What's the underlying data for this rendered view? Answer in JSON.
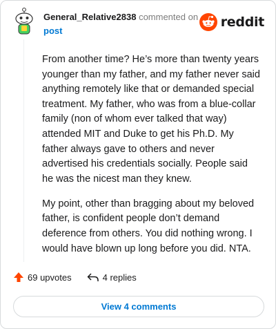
{
  "comment": {
    "username": "General_Relative2838",
    "action": "commented on",
    "post_link": "post",
    "paragraphs": [
      "From another time? He’s more than twenty years younger than my father, and my father never said anything remotely like that or demanded special treatment. My father, who was from a blue-collar family (non of whom ever talked that way) attended MIT and Duke to get his Ph.D. My father always gave to others and never advertised his credentials socially. People said he was the nicest man they knew.",
      "My point, other than bragging about my beloved father, is confident people don’t demand deference from others. You did nothing wrong. I would have blown up long before you did. NTA."
    ]
  },
  "brand": {
    "wordmark": "reddit",
    "icon": "reddit-logo-icon",
    "color": "#ff4500"
  },
  "stats": {
    "upvotes": "69 upvotes",
    "replies": "4 replies",
    "upvote_icon": "upvote-arrow-icon",
    "reply_icon": "reply-arrow-icon"
  },
  "actions": {
    "view_comments": "View 4 comments"
  },
  "colors": {
    "link": "#0079d3",
    "upvote": "#ff4500",
    "text": "#1a1a1b",
    "muted": "#7c7c7c"
  }
}
